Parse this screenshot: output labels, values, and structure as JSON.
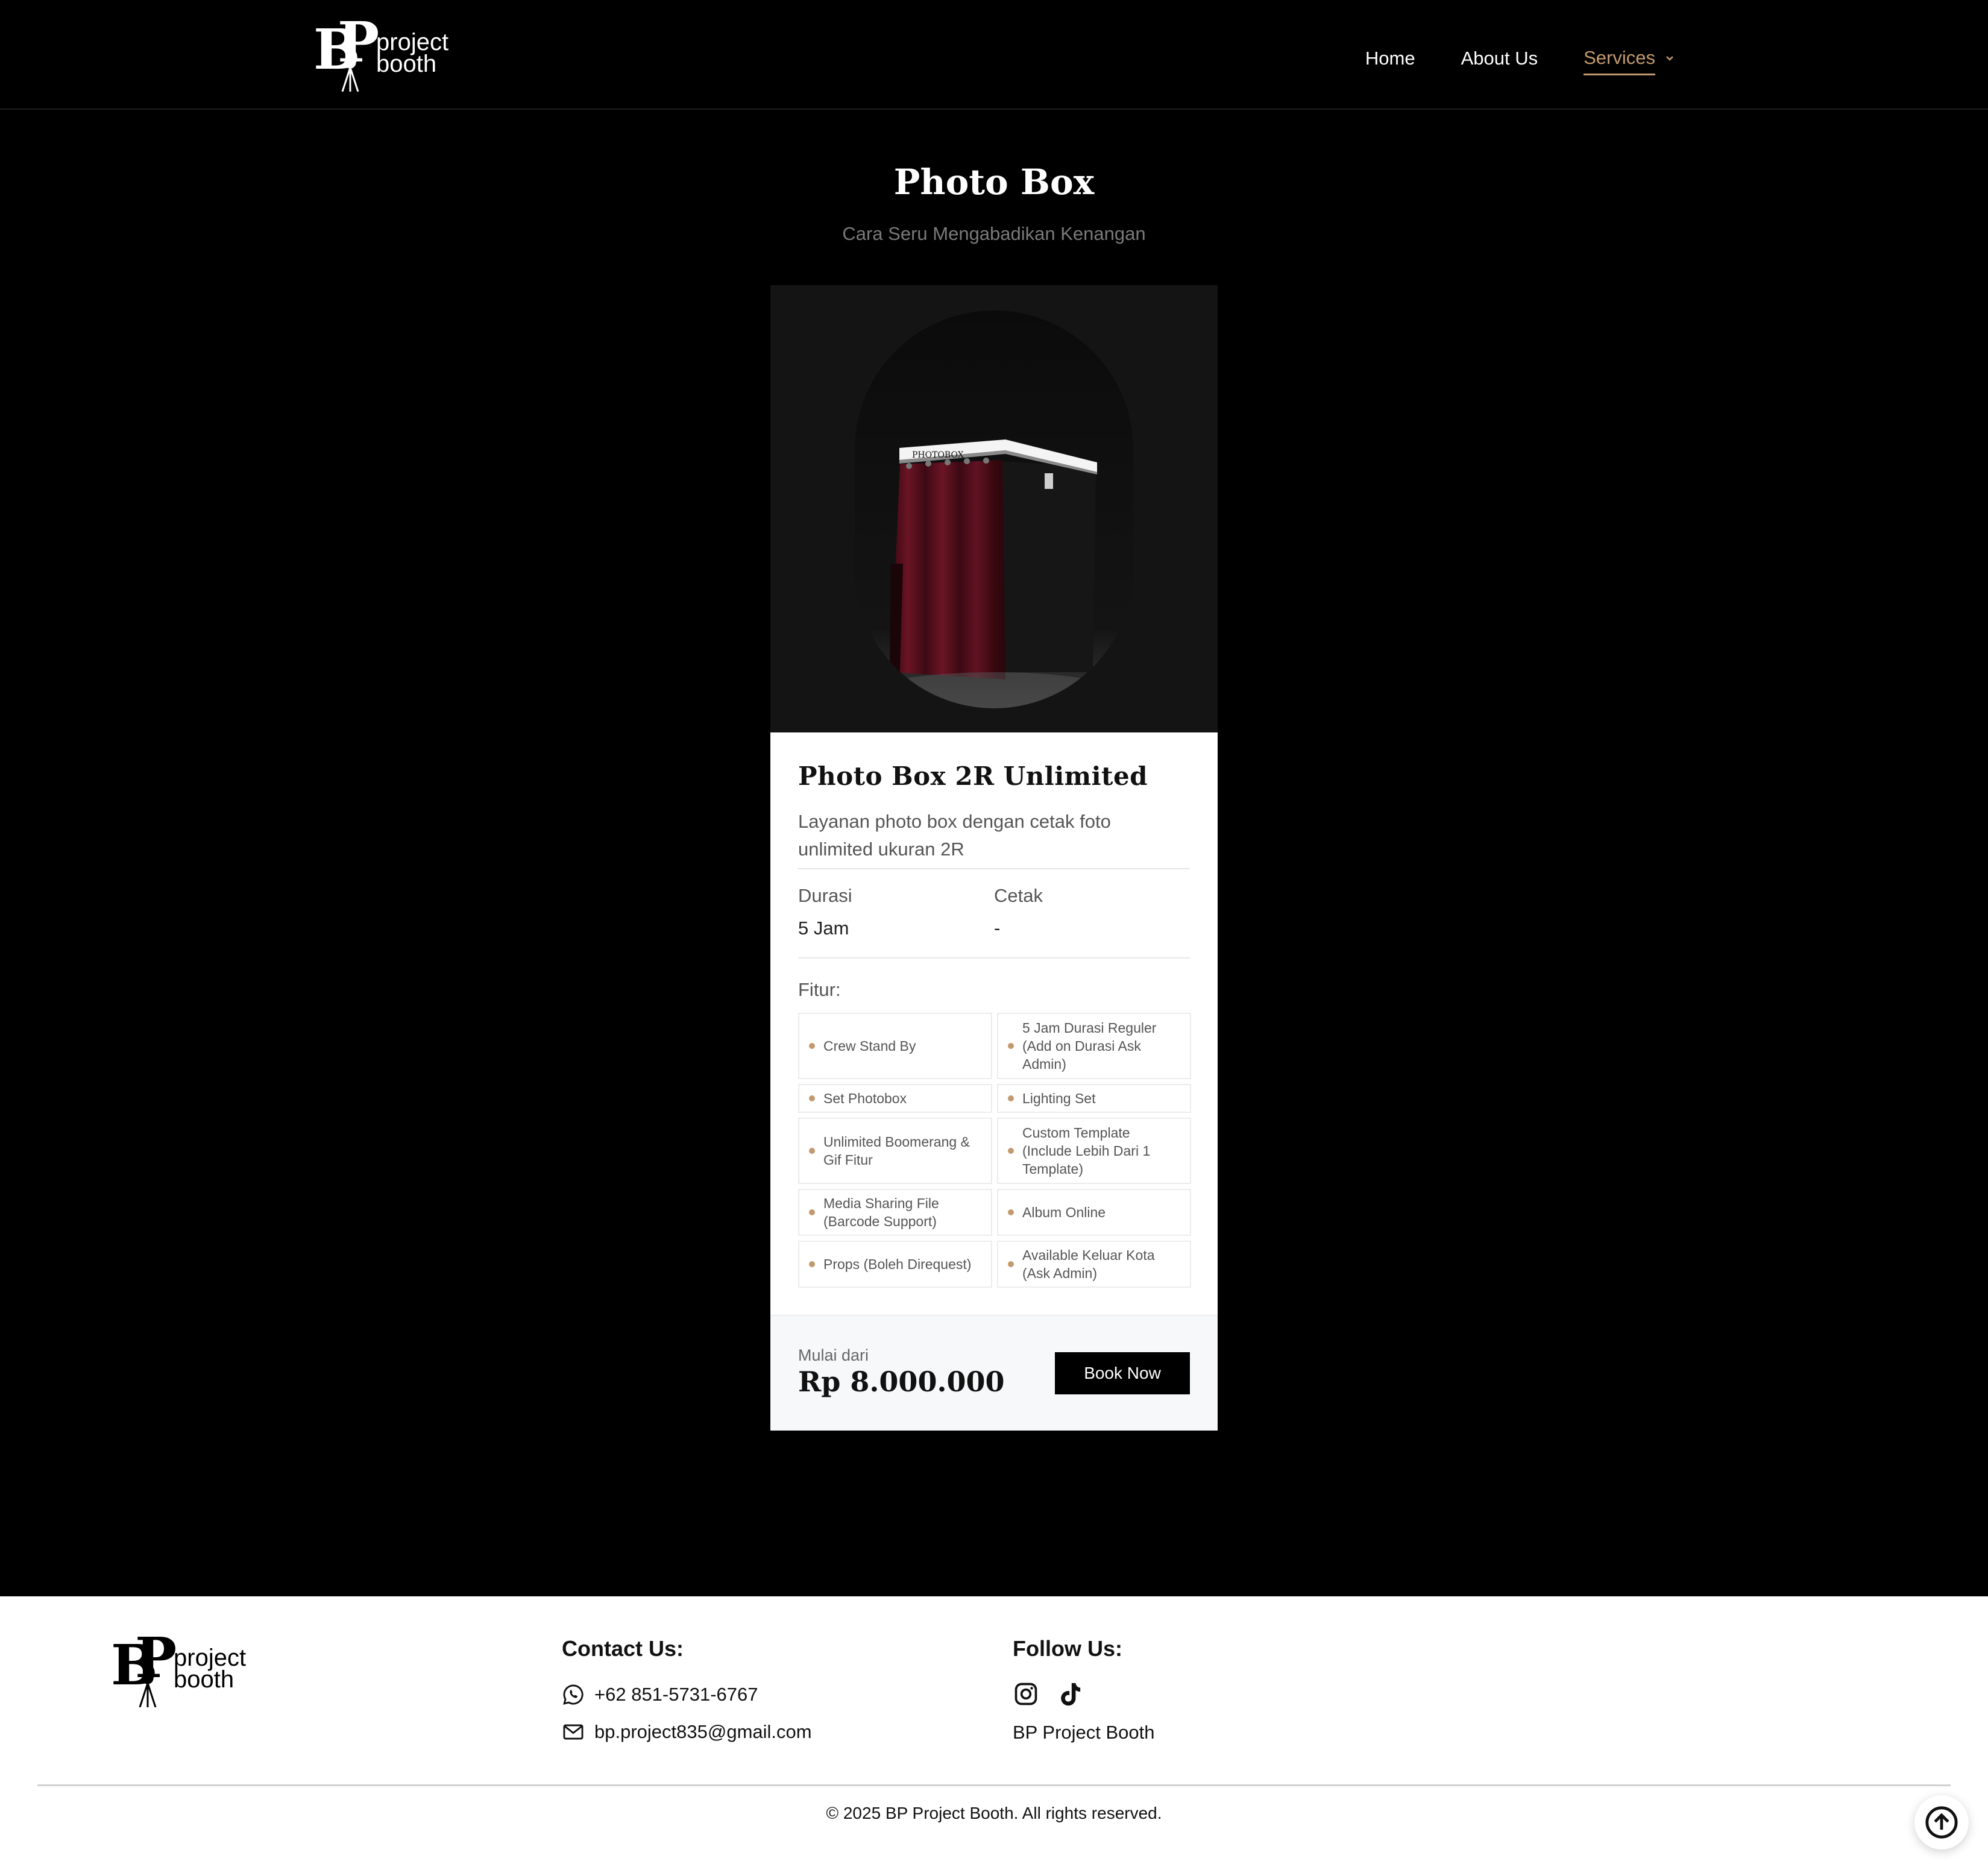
{
  "brand": {
    "line1": "project",
    "line2": "booth"
  },
  "nav": {
    "items": [
      {
        "label": "Home"
      },
      {
        "label": "About Us"
      },
      {
        "label": "Services"
      }
    ]
  },
  "page": {
    "title": "Photo Box",
    "subtitle": "Cara Seru Mengabadikan Kenangan"
  },
  "product": {
    "title": "Photo Box 2R Unlimited",
    "description": "Layanan photo box dengan cetak foto unlimited ukuran 2R",
    "specs": [
      {
        "label": "Durasi",
        "value": "5 Jam"
      },
      {
        "label": "Cetak",
        "value": "-"
      }
    ],
    "features_label": "Fitur:",
    "features": [
      "Crew Stand By",
      "5 Jam Durasi Reguler (Add on Durasi Ask Admin)",
      "Set Photobox",
      "Lighting Set",
      "Unlimited Boomerang & Gif Fitur",
      "Custom Template (Include Lebih Dari 1 Template)",
      "Media Sharing File (Barcode Support)",
      "Album Online",
      "Props (Boleh Direquest)",
      "Available Keluar Kota (Ask Admin)"
    ],
    "price_label": "Mulai dari",
    "price": "Rp 8.000.000",
    "book_label": "Book Now",
    "booth_sign": "PHOTOBOX"
  },
  "footer": {
    "contact_heading": "Contact Us:",
    "phone": "+62 851-5731-6767",
    "email": "bp.project835@gmail.com",
    "follow_heading": "Follow Us:",
    "social_name": "BP Project Booth",
    "copyright": "© 2025 BP Project Booth. All rights reserved."
  },
  "colors": {
    "accent": "#c39a6f",
    "background": "#000000",
    "curtain": "#5a0f1c"
  },
  "icons": [
    "tripod-icon",
    "chevron-down-icon",
    "whatsapp-icon",
    "mail-icon",
    "instagram-icon",
    "tiktok-icon",
    "arrow-up-icon"
  ]
}
